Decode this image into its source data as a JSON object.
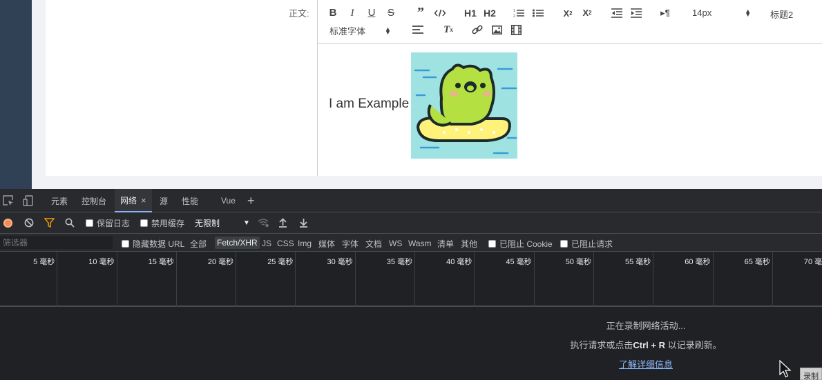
{
  "form": {
    "label": "正文:"
  },
  "editor": {
    "font_size_select": "14px",
    "heading_select": "标题2",
    "font_family_select": "标准字体",
    "h1_label": "H1",
    "h2_label": "H2",
    "body_text": "I am Example",
    "image_alt": "frog sticker"
  },
  "devtools": {
    "tabs": [
      {
        "label": "元素"
      },
      {
        "label": "控制台"
      },
      {
        "label": "网络"
      },
      {
        "label": "源"
      },
      {
        "label": "性能"
      },
      {
        "label": "Vue"
      }
    ],
    "close_glyph": "×",
    "add_glyph": "+",
    "toolbar": {
      "preserve_log": "保留日志",
      "disable_cache": "禁用缓存",
      "throttling": "无限制"
    },
    "filter": {
      "placeholder": "筛选器",
      "hide_data_urls": "隐藏数据 URL",
      "types": [
        "全部",
        "Fetch/XHR",
        "JS",
        "CSS",
        "Img",
        "媒体",
        "字体",
        "文档",
        "WS",
        "Wasm",
        "清单",
        "其他"
      ],
      "active_type": "Fetch/XHR",
      "blocked_cookies": "已阻止 Cookie",
      "blocked_requests": "已阻止请求"
    },
    "timeline_ticks": [
      "5 毫秒",
      "10 毫秒",
      "15 毫秒",
      "20 毫秒",
      "25 毫秒",
      "30 毫秒",
      "35 毫秒",
      "40 毫秒",
      "45 毫秒",
      "50 毫秒",
      "55 毫秒",
      "60 毫秒",
      "65 毫秒",
      "70 毫秒"
    ],
    "empty": {
      "line1": "正在录制网络活动...",
      "line2_prefix": "执行请求或点击",
      "line2_keys": "Ctrl + R",
      "line2_suffix": " 以记录刷新。",
      "link": "了解详细信息"
    },
    "record_badge": "录制"
  }
}
